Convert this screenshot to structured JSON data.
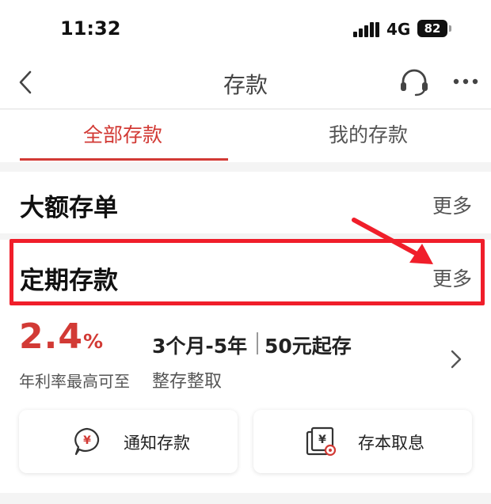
{
  "status_bar": {
    "time": "11:32",
    "network": "4G",
    "battery": "82",
    "icons": [
      "signal-icon",
      "battery-icon"
    ]
  },
  "nav": {
    "title": "存款",
    "icons": [
      "back-icon",
      "headset-icon",
      "more-icon"
    ]
  },
  "tabs": [
    {
      "label": "全部存款",
      "active": true
    },
    {
      "label": "我的存款",
      "active": false
    }
  ],
  "large_deposit": {
    "title": "大额存单",
    "more": "更多"
  },
  "fixed_deposit": {
    "title": "定期存款",
    "more": "更多",
    "rate": "2.4",
    "rate_unit": "%",
    "rate_label": "年利率最高可至",
    "term": "3个月-5年",
    "min_deposit": "50元起存",
    "product_type": "整存整取"
  },
  "cards": [
    {
      "label": "通知存款",
      "icon": "yen-speech-bubble-icon"
    },
    {
      "label": "存本取息",
      "icon": "yen-document-icon"
    }
  ],
  "colors": {
    "accent": "#d23a35",
    "highlight": "#f01e2a"
  }
}
